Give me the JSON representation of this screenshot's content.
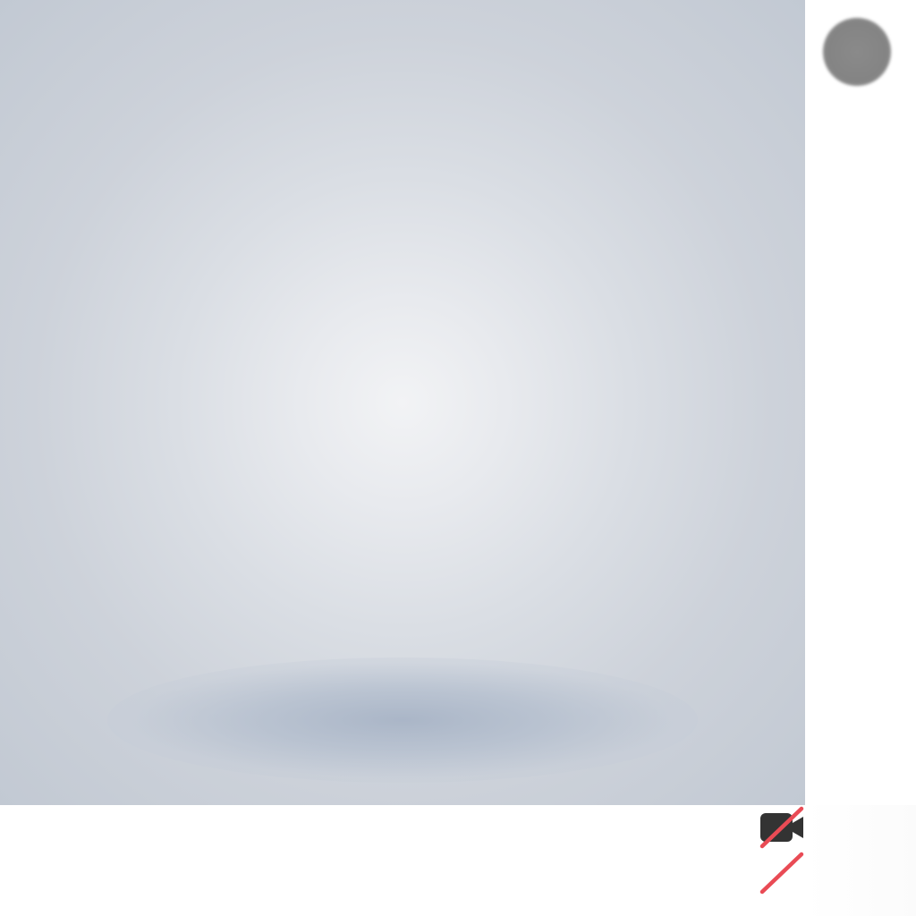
{
  "app": {
    "name": "video-call"
  },
  "video_tile": {
    "state": "camera-off-placeholder"
  },
  "participant": {
    "avatar_icon": "avatar-placeholder"
  },
  "controls": {
    "camera": {
      "icon": "video-camera-off-icon",
      "state": "off",
      "icon_color": "#333333",
      "slash_color": "#e94b55"
    },
    "microphone": {
      "icon": "microphone-off-icon",
      "state": "off",
      "slash_color": "#e94b55"
    }
  },
  "colors": {
    "video_background_center": "#f2f3f5",
    "video_background_edge": "#c2c9d3",
    "avatar": "#878787",
    "muted_red": "#e94b55"
  }
}
